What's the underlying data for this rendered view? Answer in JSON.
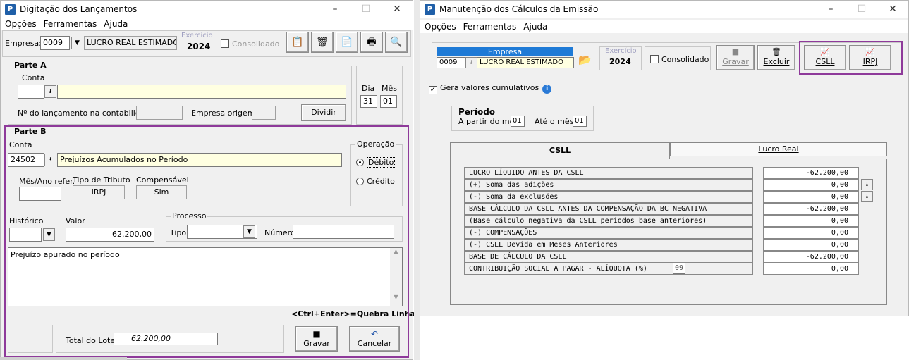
{
  "left_window": {
    "title": "Digitação dos Lançamentos",
    "menu": [
      "Opções",
      "Ferramentas",
      "Ajuda"
    ],
    "toolbar": {
      "empresa_label": "Empresa:",
      "empresa_code": "0009",
      "empresa_name": "LUCRO REAL ESTIMADO",
      "exercicio_label": "Exercício",
      "exercicio_value": "2024",
      "consolidado_label": "Consolidado"
    },
    "parte_a": {
      "title": "Parte A",
      "conta_label": "Conta",
      "conta_code": "",
      "conta_desc": "",
      "dia_label": "Dia",
      "mes_label": "Mês",
      "dia_value": "31",
      "mes_value": "01",
      "lancamento_label": "Nº do lançamento na contabilidade:",
      "empresa_origem_label": "Empresa origem:",
      "dividir_label": "Dividir"
    },
    "parte_b": {
      "title": "Parte B",
      "conta_label": "Conta",
      "conta_code": "24502",
      "conta_desc": "Prejuízos Acumulados no Período",
      "operacao_label": "Operação",
      "debito_label": "Débito",
      "credito_label": "Crédito",
      "mes_ano_label": "Mês/Ano refer.",
      "tipo_tributo_label": "Tipo de Tributo",
      "tipo_tributo_value": "IRPJ",
      "compensavel_label": "Compensável",
      "compensavel_value": "Sim"
    },
    "historico_label": "Histórico",
    "valor_label": "Valor",
    "valor_value": "62.200,00",
    "processo_label": "Processo",
    "tipo_label": "Tipo:",
    "numero_label": "Número:",
    "historico_text": "Prejuízo apurado no período",
    "hint": "<Ctrl+Enter>=Quebra Linha",
    "total_lote_label": "Total do Lote",
    "total_lote_value": "62.200,00",
    "gravar_label": "Gravar",
    "cancelar_label": "Cancelar"
  },
  "right_window": {
    "title": "Manutenção dos Cálculos da Emissão",
    "menu": [
      "Opções",
      "Ferramentas",
      "Ajuda"
    ],
    "empresa_header": "Empresa",
    "empresa_code": "0009",
    "empresa_name": "LUCRO REAL ESTIMADO",
    "exercicio_label": "Exercício",
    "exercicio_value": "2024",
    "consolidado_label": "Consolidado",
    "gravar_label": "Gravar",
    "excluir_label": "Excluir",
    "csll_label": "CSLL",
    "irpj_label": "IRPJ",
    "gera_label": "Gera valores cumulativos",
    "periodo_title": "Período",
    "a_partir_label": "A partir do mês",
    "a_partir_value": "01",
    "ate_label": "Até o mês",
    "ate_value": "01",
    "tabs": [
      "CSLL",
      "Lucro Real"
    ],
    "aliquota_value": "09",
    "rows": [
      {
        "label": "LUCRO LÍQUIDO ANTES DA CSLL",
        "value": "-62.200,00"
      },
      {
        "label": "(+) Soma das adições",
        "value": "0,00"
      },
      {
        "label": "(-) Soma da exclusões",
        "value": "0,00"
      },
      {
        "label": "BASE CÁLCULO DA CSLL ANTES DA COMPENSAÇÃO DA BC NEGATIVA",
        "value": "-62.200,00"
      },
      {
        "label": "(Base cálculo negativa da CSLL periodos base anteriores)",
        "value": "0,00"
      },
      {
        "label": "(-) COMPENSAÇÕES",
        "value": "0,00"
      },
      {
        "label": "(-) CSLL Devida em Meses Anteriores",
        "value": "0,00"
      },
      {
        "label": "BASE DE CÁLCULO DA CSLL",
        "value": "-62.200,00"
      },
      {
        "label": "CONTRIBUIÇÃO SOCIAL A PAGAR - ALÍQUOTA (%)",
        "value": "0,00"
      }
    ]
  }
}
